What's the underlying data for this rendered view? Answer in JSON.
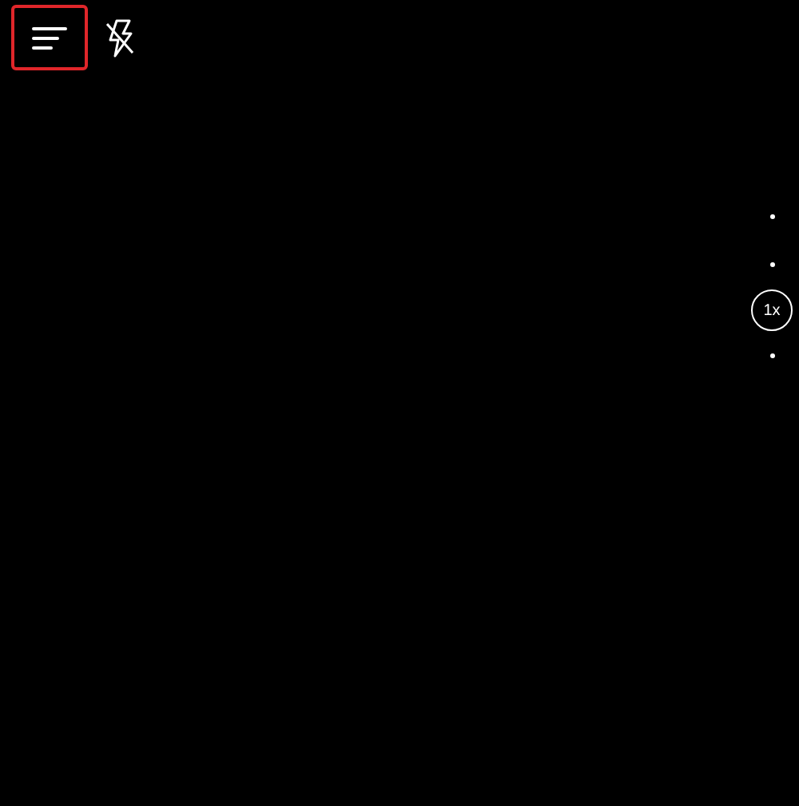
{
  "toolbar": {
    "menu_button": {
      "highlighted": true
    },
    "flash": {
      "on": false
    }
  },
  "zoom_control": {
    "label": "1x"
  }
}
